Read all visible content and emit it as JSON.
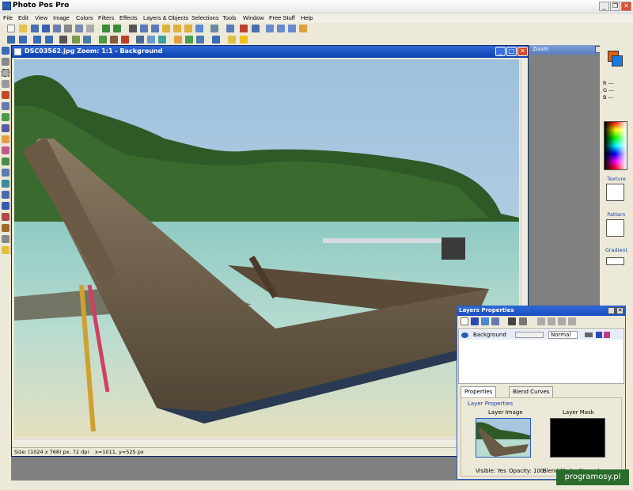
{
  "app": {
    "title": "Photo Pos Pro"
  },
  "menu": [
    "File",
    "Edit",
    "View",
    "Image",
    "Colors",
    "Filters",
    "Effects",
    "Layers & Objects",
    "Selections",
    "Tools",
    "Window",
    "Free Stuff",
    "Help"
  ],
  "document": {
    "title": "DSC03562.jpg  Zoom: 1:1 - Background",
    "status_size": "Size: (1024 x 768) px, 72 dpi",
    "status_coords": "x=1011, y=525 px"
  },
  "zoom_panel": {
    "title": "Zoom"
  },
  "color_panel": {
    "r": "R ---",
    "g": "G ---",
    "b": "B ---",
    "texture_label": "Texture",
    "pattern_label": "Pattern",
    "gradient_label": "Gradient",
    "fg_color": "#e06010",
    "bg_color": "#1a7ae0"
  },
  "layers": {
    "title": "Layers Properties",
    "rows": [
      {
        "name": "Background",
        "mode": "Normal"
      }
    ],
    "tabs": [
      "Properties",
      "Blend Curves"
    ],
    "group_label": "Layer Properties",
    "image_label": "Layer Image",
    "mask_label": "Layer Mask",
    "visible": "Visible: Yes",
    "opacity": "Opacity: 100",
    "blend": "Blend Mode: Normal"
  },
  "watermark": "programosy.pl"
}
